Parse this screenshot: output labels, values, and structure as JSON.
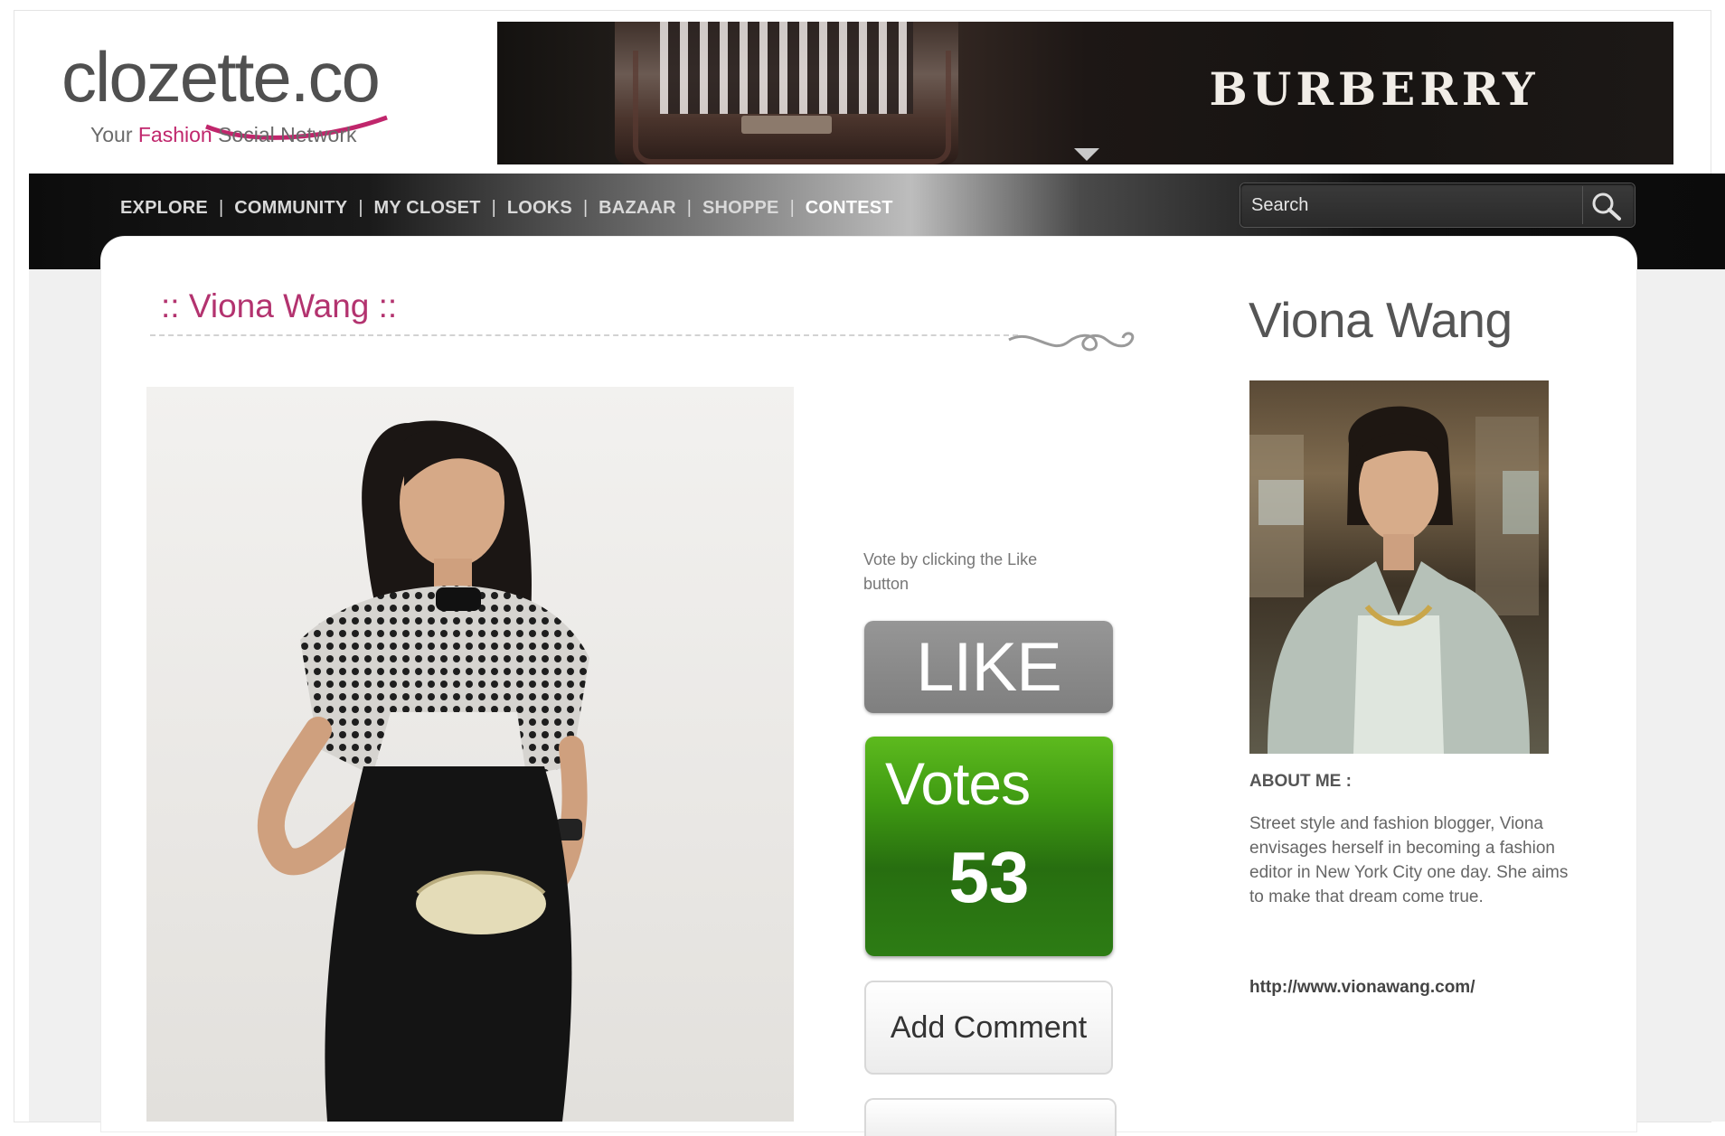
{
  "logo": {
    "wordmark": "clozette.co",
    "tagline_prefix": "Your ",
    "tagline_highlight": "Fashion",
    "tagline_suffix": " Social Network",
    "accent_color": "#c0266c"
  },
  "banner_ad": {
    "brand": "BURBERRY"
  },
  "nav": {
    "items": [
      {
        "label": "EXPLORE"
      },
      {
        "label": "COMMUNITY"
      },
      {
        "label": "MY CLOSET"
      },
      {
        "label": "LOOKS"
      },
      {
        "label": "BAZAAR"
      },
      {
        "label": "SHOPPE"
      },
      {
        "label": "CONTEST",
        "active": true
      }
    ],
    "separator": "|"
  },
  "search": {
    "placeholder": "Search",
    "icon": "magnifier-icon"
  },
  "entry": {
    "title": ":: Viona Wang ::",
    "title_color": "#b3336f"
  },
  "voting": {
    "hint": "Vote by clicking the Like button",
    "like_label": "LIKE",
    "votes_label": "Votes",
    "votes_count": "53",
    "votes_color": "#3f9a12",
    "add_comment_label": "Add Comment"
  },
  "profile": {
    "name": "Viona Wang",
    "about_heading": "ABOUT ME :",
    "about_text": "Street style and fashion blogger, Viona envisages herself in becoming a fashion editor in New York City one day. She aims to make that dream come true.",
    "link": "http://www.vionawang.com/"
  }
}
